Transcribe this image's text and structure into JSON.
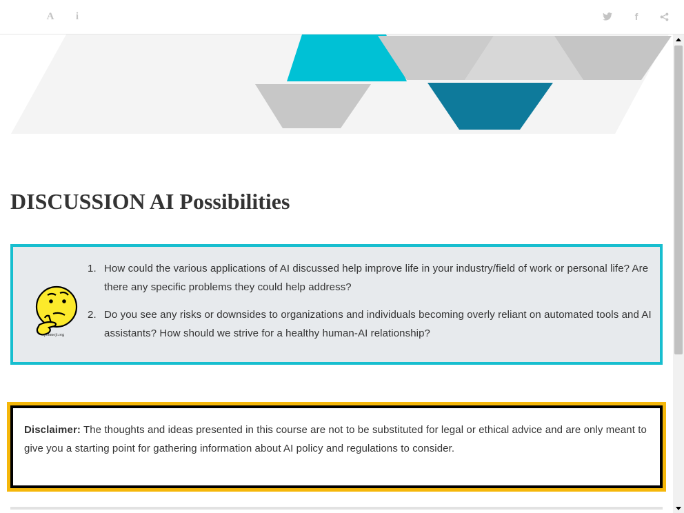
{
  "toolbar": {
    "font_icon": "A",
    "info_icon": "i",
    "facebook_icon": "f"
  },
  "icons": {
    "font": "font-icon",
    "info": "info-icon",
    "twitter": "twitter-icon",
    "facebook": "facebook-icon",
    "share": "share-icon",
    "emoji": "thinking-face-icon"
  },
  "page": {
    "title": "DISCUSSION AI Possibilities"
  },
  "discussion": {
    "emoji_caption": "openmoji.org",
    "questions": [
      {
        "number": "1.",
        "text": "How could the various applications of AI discussed help improve life in your industry/field of work or personal life? Are there any specific problems they could help address?"
      },
      {
        "number": "2.",
        "text": "Do you see any risks or downsides to organizations and individuals becoming overly reliant on automated tools and AI assistants? How should we strive for a healthy human-AI relationship?"
      }
    ]
  },
  "disclaimer": {
    "label": "Disclaimer:",
    "text": " The thoughts and ideas presented in this course are not to be substituted for legal or ethical advice and are only meant to give you a starting point for gathering information about AI policy and regulations to consider."
  },
  "colors": {
    "banner_cyan": "#00c1d5",
    "banner_teal": "#0e7a9b",
    "banner_gray": "#cbcbcb",
    "banner_light": "#f4f4f4",
    "discussion_border": "#17becf",
    "discussion_bg": "#e7eaed",
    "disclaimer_border": "#f5b70a",
    "emoji_yellow": "#fcea2b"
  }
}
